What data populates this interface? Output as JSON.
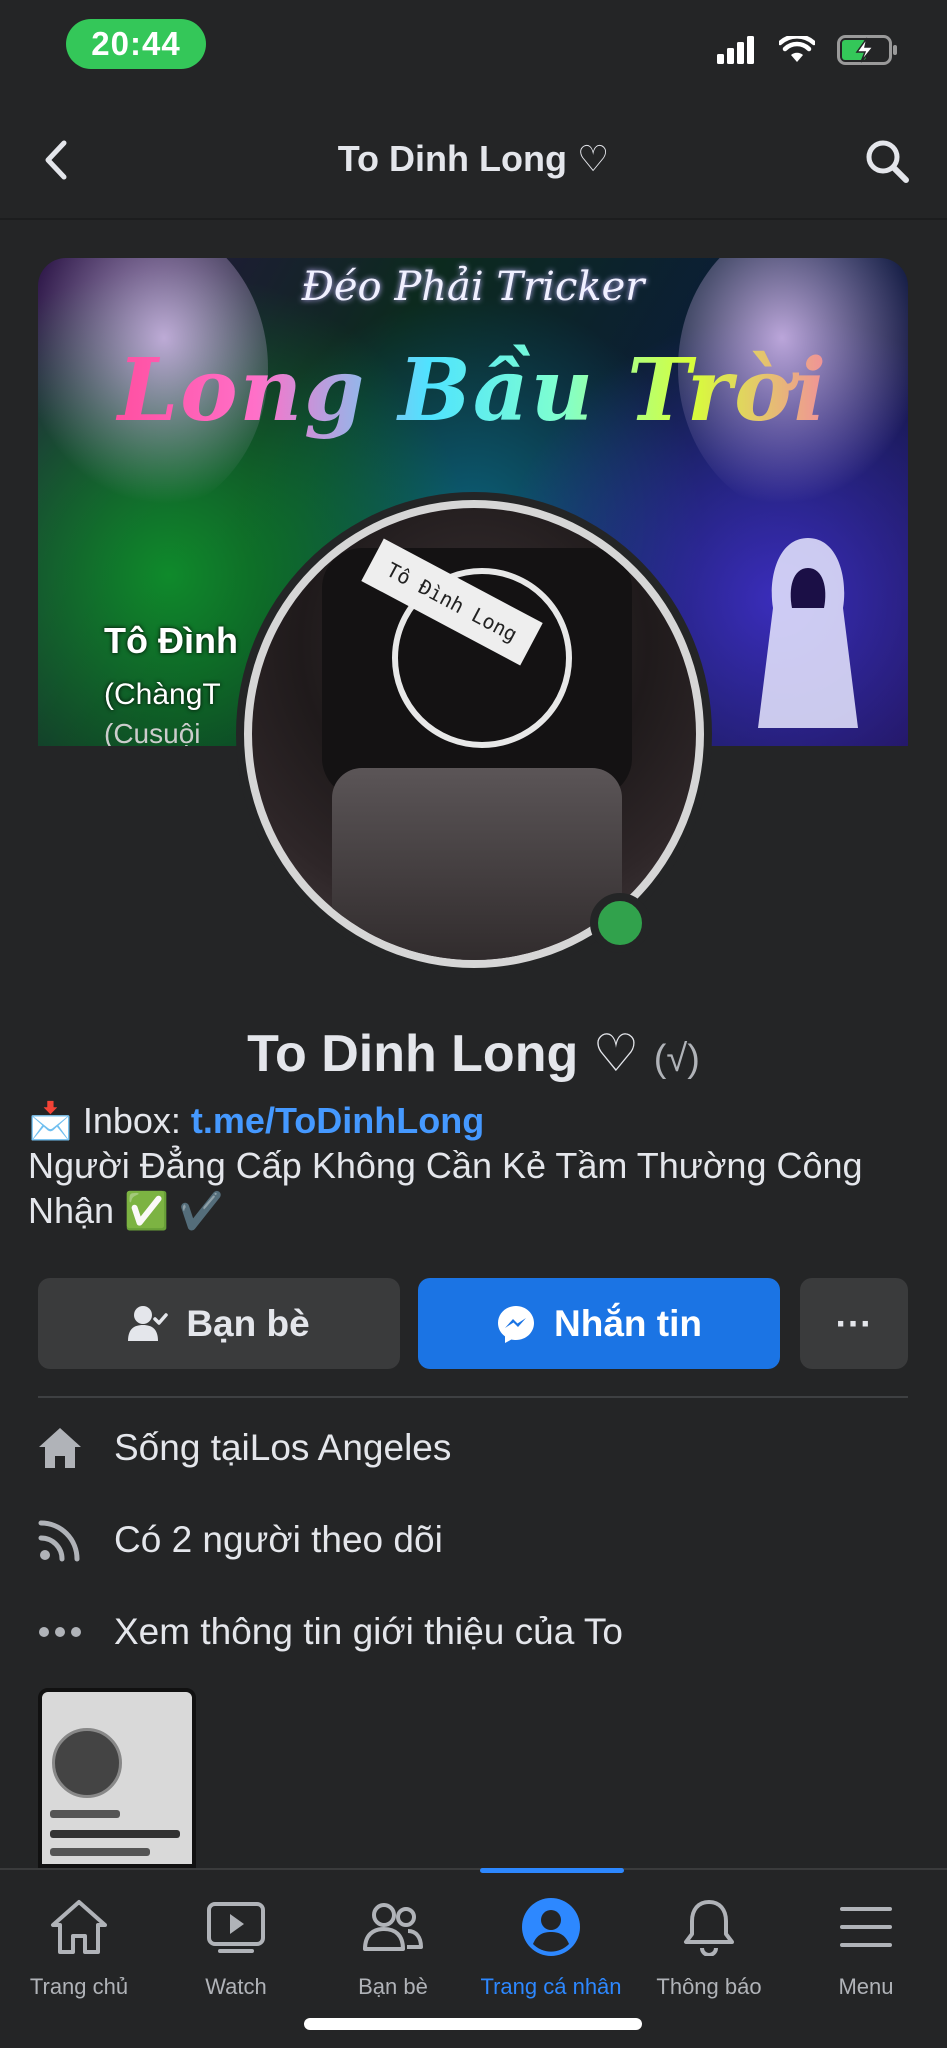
{
  "status_bar": {
    "time": "20:44"
  },
  "header": {
    "title": "To Dinh Long ♡"
  },
  "cover": {
    "subtitle": "Đéo Phải Tricker",
    "title": "Long Bầu Trời",
    "name_line": "Tô Đình",
    "name_line2": "(ChàngT",
    "name_line3": "(Cusuội"
  },
  "avatar": {
    "card_text": "Tô Đình Long"
  },
  "profile": {
    "name": "To Dinh Long ♡",
    "verified_mark": "(√)"
  },
  "bio": {
    "inbox_emoji": "📩",
    "inbox_label": "Inbox: ",
    "inbox_link": "t.me/ToDinhLong",
    "line2": "Người Đẳng Cấp Không Cần Kẻ Tầm Thường Công Nhận ✅ ✔️"
  },
  "actions": {
    "friends_label": "Bạn bè",
    "message_label": "Nhắn tin",
    "more_label": "···"
  },
  "details": [
    {
      "icon": "home-icon",
      "prefix": "Sống tại ",
      "value": "Los Angeles"
    },
    {
      "icon": "rss-icon",
      "prefix": "Có 2 người theo dõi",
      "value": ""
    },
    {
      "icon": "more-dots-icon",
      "prefix": "Xem thông tin giới thiệu của To",
      "value": ""
    }
  ],
  "nav": [
    {
      "label": "Trang chủ",
      "icon": "home-icon"
    },
    {
      "label": "Watch",
      "icon": "watch-icon"
    },
    {
      "label": "Bạn bè",
      "icon": "friends-icon"
    },
    {
      "label": "Trang cá nhân",
      "icon": "profile-icon",
      "active": true
    },
    {
      "label": "Thông báo",
      "icon": "bell-icon"
    },
    {
      "label": "Menu",
      "icon": "menu-icon"
    }
  ],
  "colors": {
    "accent": "#1b74e4",
    "online": "#31a24c",
    "link": "#4599ff",
    "background": "#242526"
  }
}
